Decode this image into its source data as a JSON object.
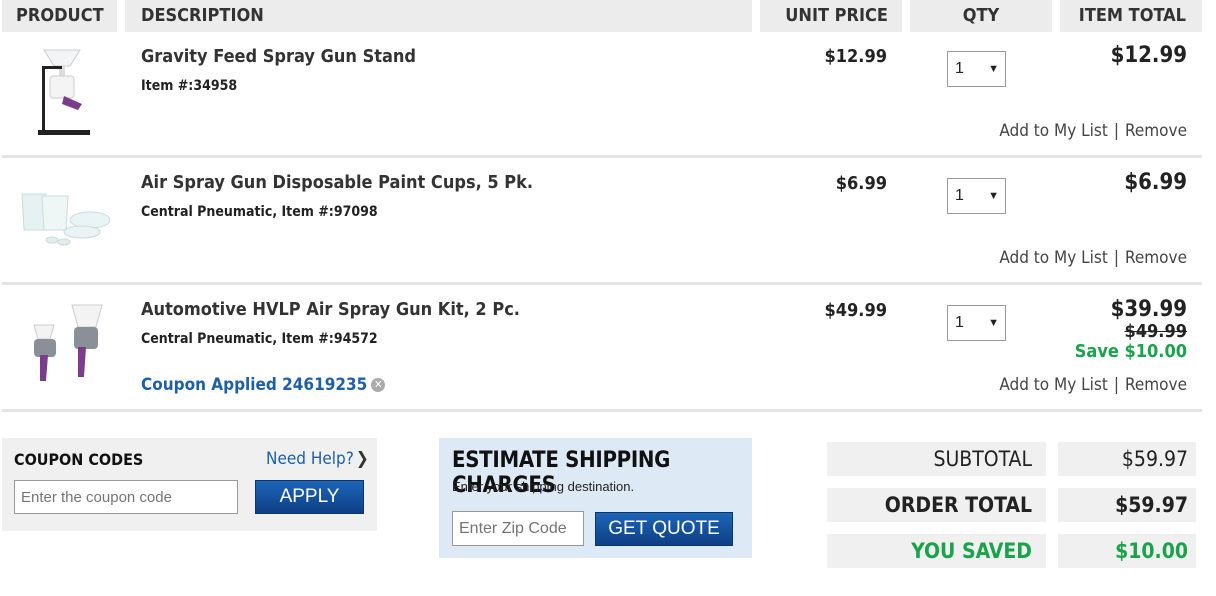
{
  "header": {
    "product": "PRODUCT",
    "description": "DESCRIPTION",
    "unit_price": "UNIT PRICE",
    "qty": "QTY",
    "item_total": "ITEM TOTAL"
  },
  "items": [
    {
      "name": "Gravity Feed Spray Gun Stand",
      "item_line": "Item #:34958",
      "unit_price": "$12.99",
      "qty": "1",
      "total": "$12.99",
      "add_to_list": "Add to My List",
      "separator": "|",
      "remove": "Remove",
      "image_icon": "spray-gun-stand-image"
    },
    {
      "name": "Air Spray Gun Disposable Paint Cups, 5 Pk.",
      "item_line": "Central Pneumatic, Item #:97098",
      "unit_price": "$6.99",
      "qty": "1",
      "total": "$6.99",
      "add_to_list": "Add to My List",
      "separator": "|",
      "remove": "Remove",
      "image_icon": "paint-cups-image"
    },
    {
      "name": "Automotive HVLP Air Spray Gun Kit, 2 Pc.",
      "item_line": "Central Pneumatic, Item #:94572",
      "coupon_applied": "Coupon Applied 24619235",
      "unit_price": "$49.99",
      "qty": "1",
      "total": "$39.99",
      "was_price": "$49.99",
      "savings": "Save $10.00",
      "add_to_list": "Add to My List",
      "separator": "|",
      "remove": "Remove",
      "image_icon": "spray-gun-kit-image"
    }
  ],
  "coupon": {
    "title": "COUPON CODES",
    "help": "Need Help?",
    "placeholder": "Enter the coupon code",
    "apply": "APPLY"
  },
  "shipping": {
    "title": "ESTIMATE SHIPPING CHARGES",
    "subtitle": "Enter your shipping destination.",
    "zip_placeholder": "Enter Zip Code",
    "button": "GET QUOTE"
  },
  "totals": {
    "subtotal_label": "SUBTOTAL",
    "subtotal_value": "$59.97",
    "order_total_label": "ORDER TOTAL",
    "order_total_value": "$59.97",
    "saved_label": "YOU SAVED",
    "saved_value": "$10.00"
  },
  "colors": {
    "link_blue": "#1d5fa8",
    "save_green": "#1aa34a",
    "button_blue": "#1a5aa8",
    "header_gray": "#ececec"
  }
}
